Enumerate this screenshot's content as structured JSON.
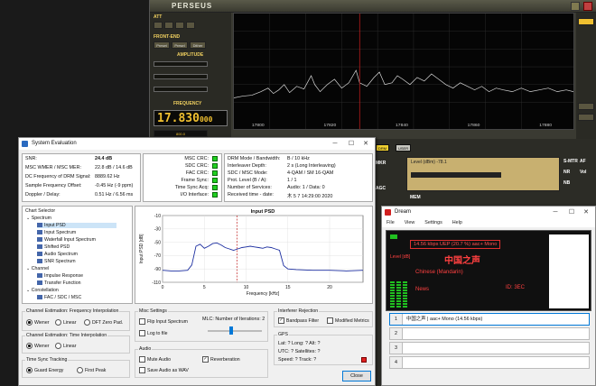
{
  "perseus": {
    "title": "PERSEUS",
    "att_label": "ATT",
    "frontend_label": "FRONT-END",
    "frontend_buttons": [
      "Preset",
      "Presel",
      "Dither"
    ],
    "amplitude_label": "AMPLITUDE",
    "frequency_label": "FREQUENCY",
    "frequency_value": "17.830",
    "frequency_suffix": "000",
    "drm_tag": "DRM",
    "user_tag": "USER",
    "mkr_label": "MKR",
    "agc_label": "AGC",
    "mem_label": "MEM",
    "level_label": "Level (dBm) -78.1",
    "smtr_label": "S-MTR",
    "nr_label": "NR",
    "nb_label": "NB",
    "af_label": "AF",
    "vol_label": "Vol",
    "freq_ticks": [
      "17800",
      "17820",
      "17840",
      "17860",
      "17880"
    ],
    "bandwidth_value": "800.0"
  },
  "syseval": {
    "title": "System Evaluation",
    "stats": [
      {
        "key": "SNR:",
        "value": "24.4 dB"
      },
      {
        "key": "MSC WMER / MSC MER:",
        "value": "22.8 dB / 14.6 dB"
      },
      {
        "key": "DC Frequency of DRM Signal:",
        "value": "8889.62 Hz"
      },
      {
        "key": "Sample Frequency Offset:",
        "value": "-0.45 Hz (-9 ppm)"
      },
      {
        "key": "Doppler / Delay:",
        "value": "0.51 Hz / 6.56 ms"
      }
    ],
    "crc": [
      "MSC CRC:",
      "SDC CRC:",
      "FAC CRC:",
      "Frame Sync:",
      "Time Sync Acq:",
      "I/O Interface:"
    ],
    "params": [
      {
        "key": "DRM Mode / Bandwidth:",
        "value": "B / 10 kHz"
      },
      {
        "key": "Interleaver Depth:",
        "value": "2 s (Long Interleaving)"
      },
      {
        "key": "SDC / MSC Mode:",
        "value": "4-QAM / SM 16-QAM"
      },
      {
        "key": "Prot. Level (B / A):",
        "value": "1 / 1"
      },
      {
        "key": "Number of Services:",
        "value": "Audio: 1 / Data: 0"
      },
      {
        "key": "Received time - date:",
        "value": "木 5 7 14:29:00 2020"
      }
    ],
    "chart_selector": {
      "title": "Chart Selector",
      "items": [
        {
          "label": "Spectrum",
          "level": 0,
          "icon": false
        },
        {
          "label": "Input PSD",
          "level": 1,
          "icon": true,
          "selected": true
        },
        {
          "label": "Input Spectrum",
          "level": 1,
          "icon": true
        },
        {
          "label": "Waterfall Input Spectrum",
          "level": 1,
          "icon": true
        },
        {
          "label": "Shifted PSD",
          "level": 1,
          "icon": true
        },
        {
          "label": "Audio Spectrum",
          "level": 1,
          "icon": true
        },
        {
          "label": "SNR Spectrum",
          "level": 1,
          "icon": true
        },
        {
          "label": "Channel",
          "level": 0,
          "icon": false
        },
        {
          "label": "Impulse Response",
          "level": 1,
          "icon": true
        },
        {
          "label": "Transfer Function",
          "level": 1,
          "icon": true
        },
        {
          "label": "Constellation",
          "level": 0,
          "icon": false
        },
        {
          "label": "FAC / SDC / MSC",
          "level": 1,
          "icon": true
        }
      ]
    },
    "freq_interp": {
      "title": "Channel Estimation: Frequency Interpolation",
      "options": [
        "Wiener",
        "Linear",
        "DFT Zero Pad."
      ],
      "selected": 0
    },
    "time_interp": {
      "title": "Channel Estimation: Time Interpolation",
      "options": [
        "Wiener",
        "Linear"
      ],
      "selected": 0
    },
    "time_sync": {
      "title": "Time Sync Tracking",
      "options": [
        "Guard Energy",
        "First Peak"
      ],
      "selected": 0
    },
    "misc": {
      "title": "Misc Settings",
      "flip": "Flip Input Spectrum",
      "log": "Log to file",
      "mlc_label": "MLC: Number of Iterations: 2"
    },
    "audio": {
      "title": "Audio",
      "mute": "Mute Audio",
      "save": "Save Audio as WAV",
      "reverb": "Reverberation"
    },
    "interferer": {
      "title": "Interferer Rejection",
      "bandpass": "Bandpass Filter",
      "modified": "Modified Metrics"
    },
    "gps": {
      "title": "GPS",
      "line1": "Lat: ?  Long: ?  Alt: ?",
      "line2": "UTC: ?  Satellites: ?",
      "line3": "Speed: ?  Track: ?"
    },
    "close_label": "Close"
  },
  "chart_data": {
    "type": "line",
    "title": "Input PSD",
    "xlabel": "Frequency [kHz]",
    "ylabel": "Input PSD [dB]",
    "xlim": [
      0,
      24
    ],
    "ylim": [
      -110,
      -10
    ],
    "xticks": [
      0,
      5,
      10,
      15,
      20
    ],
    "yticks": [
      -10,
      -30,
      -50,
      -70,
      -90,
      -110
    ],
    "grid": true,
    "marker_x": 8.9,
    "series": [
      {
        "x": [
          0,
          1,
          2,
          3,
          3.5,
          4,
          4.5,
          5,
          5.5,
          6,
          6.5,
          7,
          7.5,
          8,
          8.5,
          9,
          9.5,
          10,
          10.5,
          11,
          11.5,
          12,
          12.5,
          13,
          13.5,
          14,
          14.5,
          15,
          16,
          18,
          20,
          22,
          24
        ],
        "y": [
          -92,
          -93,
          -93,
          -92,
          -84,
          -56,
          -53,
          -59,
          -56,
          -52,
          -51,
          -54,
          -58,
          -60,
          -62,
          -60,
          -58,
          -57,
          -56,
          -57,
          -58,
          -59,
          -57,
          -58,
          -60,
          -62,
          -85,
          -90,
          -91,
          -92,
          -92,
          -93,
          -92
        ]
      }
    ]
  },
  "dream": {
    "title": "Dream",
    "menu": [
      "File",
      "View",
      "Settings",
      "Help"
    ],
    "bitrate_label": "14.56 kbps UEP (20.7 %) aac+ Mono",
    "station": "中国之声",
    "language": "Chinese (Mandarin)",
    "program_type": "News",
    "service_id": "ID: 3EC",
    "level_label": "Level [dB]",
    "channels": [
      {
        "num": "1",
        "text": "中国之声  |  aac+ Mono (14.56 kbps)"
      },
      {
        "num": "2",
        "text": ""
      },
      {
        "num": "3",
        "text": ""
      },
      {
        "num": "4",
        "text": ""
      }
    ]
  }
}
